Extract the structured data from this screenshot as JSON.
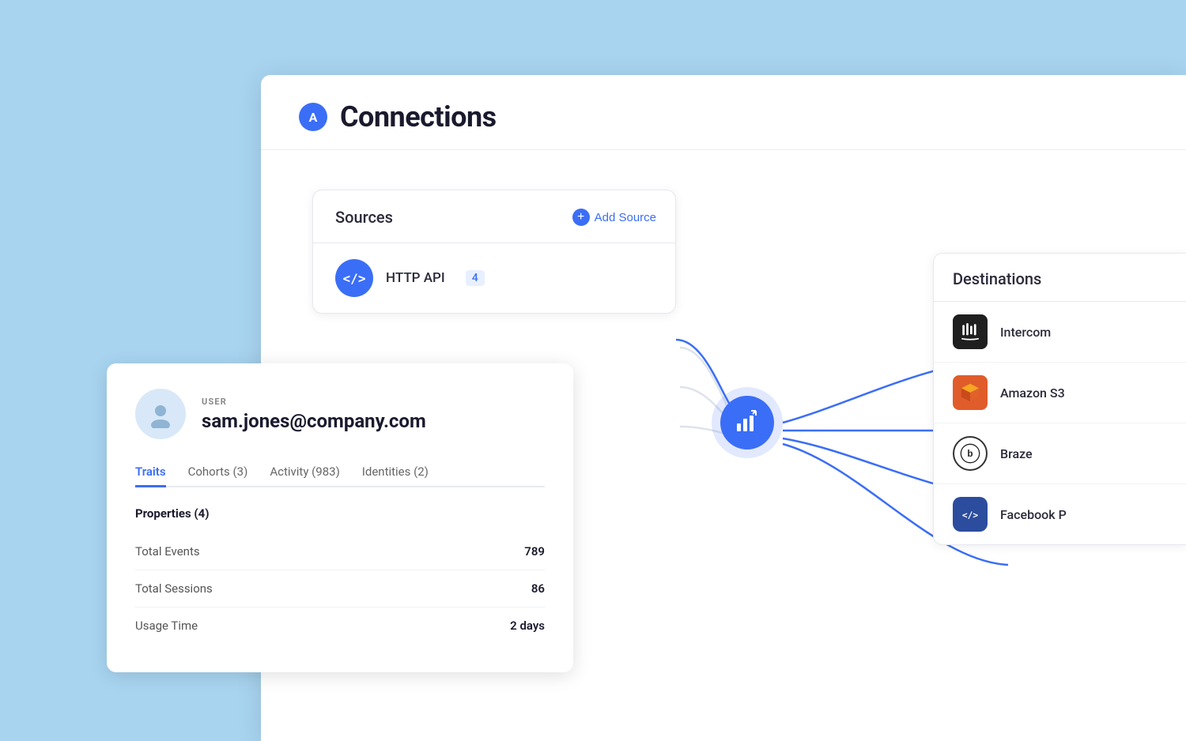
{
  "app": {
    "logo_letter": "A",
    "title": "Connections"
  },
  "sources": {
    "label": "Sources",
    "add_button": "Add Source",
    "items": [
      {
        "icon": "</> ",
        "name": "HTTP API",
        "count": "4"
      }
    ]
  },
  "destinations": {
    "label": "Destinations",
    "items": [
      {
        "name": "Intercom"
      },
      {
        "name": "Amazon S3"
      },
      {
        "name": "Braze"
      },
      {
        "name": "Facebook P"
      }
    ]
  },
  "user_card": {
    "user_label": "USER",
    "email": "sam.jones@company.com",
    "tabs": [
      {
        "label": "Traits",
        "active": true
      },
      {
        "label": "Cohorts (3)",
        "active": false
      },
      {
        "label": "Activity (983)",
        "active": false
      },
      {
        "label": "Identities (2)",
        "active": false
      }
    ],
    "properties_title": "Properties (4)",
    "properties": [
      {
        "label": "Total Events",
        "value": "789"
      },
      {
        "label": "Total Sessions",
        "value": "86"
      },
      {
        "label": "Usage Time",
        "value": "2 days"
      }
    ]
  }
}
